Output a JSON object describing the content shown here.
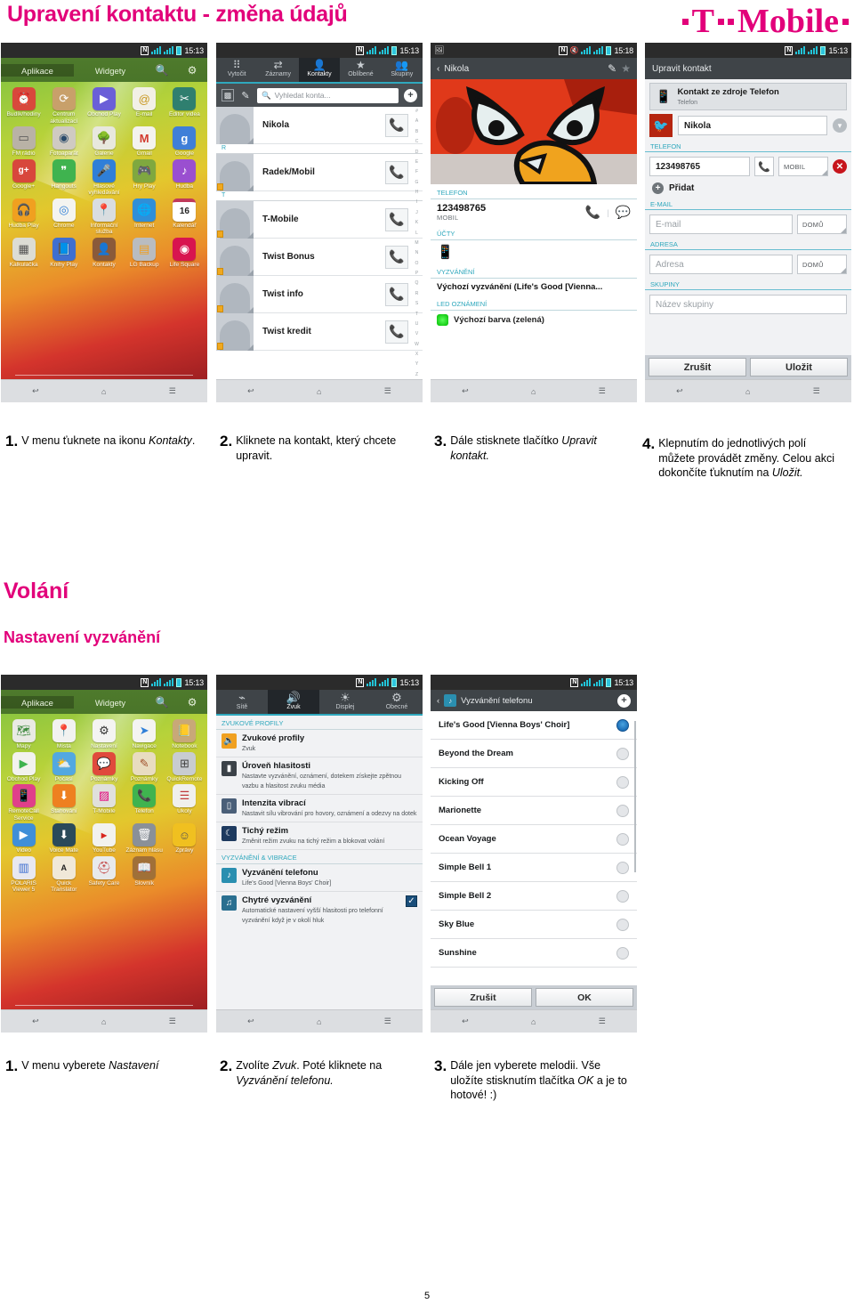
{
  "header": {
    "title": "Upravení kontaktu - změna údajů",
    "logo_t": "T",
    "logo_word": "Mobile",
    "brand_color": "#e2007a"
  },
  "sections": {
    "volani": "Volání",
    "nastaveni_vyzvaneni": "Nastavení vyzvánění"
  },
  "page_number": "5",
  "phones": {
    "home_apps": {
      "status": {
        "nfc": "N",
        "time": "15:13"
      },
      "tabs": [
        {
          "label": "Aplikace",
          "active": true
        },
        {
          "label": "Widgety",
          "active": false
        }
      ],
      "search_icon": "search-icon",
      "settings_icon": "gear-icon",
      "apps": [
        {
          "label": "Budík/hodiny",
          "glyph": "⏰",
          "color": "#d8483c"
        },
        {
          "label": "Centrum aktualizací",
          "glyph": "⟳",
          "color": "#c8a06a"
        },
        {
          "label": "Obchod Play",
          "glyph": "▶",
          "color": "#6a5fd8"
        },
        {
          "label": "E-mail",
          "glyph": "@",
          "color": "#f2f0e6"
        },
        {
          "label": "Editor videa",
          "glyph": "✂",
          "color": "#2f7f6f"
        },
        {
          "label": "FM rádio",
          "glyph": "📻",
          "color": "#b9b2a6"
        },
        {
          "label": "Fotoaparát",
          "glyph": "◉",
          "color": "#cfcac2"
        },
        {
          "label": "Galerie",
          "glyph": "🌳",
          "color": "#e8e8de"
        },
        {
          "label": "Gmail",
          "glyph": "M",
          "color": "#f4f3ee"
        },
        {
          "label": "Google",
          "glyph": "g",
          "color": "#3f7fd8"
        },
        {
          "label": "Google+",
          "glyph": "g+",
          "color": "#d8473c"
        },
        {
          "label": "Hangouts",
          "glyph": "❞",
          "color": "#3fb34f"
        },
        {
          "label": "Hlasové vyhledávání",
          "glyph": "🎤",
          "color": "#2f7fd8"
        },
        {
          "label": "Hry Play",
          "glyph": "🎮",
          "color": "#7fa83f"
        },
        {
          "label": "Hudba",
          "glyph": "♪",
          "color": "#9a4fd0"
        },
        {
          "label": "Hudba Play",
          "glyph": "🎧",
          "color": "#f0a020"
        },
        {
          "label": "Chrome",
          "glyph": "◎",
          "color": "#f4f4f0"
        },
        {
          "label": "Informační služba",
          "glyph": "📍",
          "color": "#d9dde0"
        },
        {
          "label": "Internet",
          "glyph": "🌐",
          "color": "#2f8fd8"
        },
        {
          "label": "Kalendář",
          "glyph": "16",
          "color": "#ffffff"
        },
        {
          "label": "Kalkulačka",
          "glyph": "▦",
          "color": "#dcdcd4"
        },
        {
          "label": "Knihy Play",
          "glyph": "📘",
          "color": "#3f6fd0"
        },
        {
          "label": "Kontakty",
          "glyph": "👤",
          "color": "#8a5a3a"
        },
        {
          "label": "LG Backup",
          "glyph": "▤",
          "color": "#b9bcc0"
        },
        {
          "label": "Life Square",
          "glyph": "◉",
          "color": "#d8144f"
        }
      ]
    },
    "contacts": {
      "status": {
        "nfc": "N",
        "time": "15:13"
      },
      "tabs": [
        {
          "label": "Vytočit",
          "glyph": "⠿",
          "active": false
        },
        {
          "label": "Záznamy",
          "glyph": "⇄",
          "active": false
        },
        {
          "label": "Kontakty",
          "glyph": "👤",
          "active": true
        },
        {
          "label": "Oblíbené",
          "glyph": "★",
          "active": false
        },
        {
          "label": "Skupiny",
          "glyph": "👥",
          "active": false
        }
      ],
      "search_placeholder": "Vyhledat konta...",
      "add_label": "+",
      "rows": [
        {
          "name": "Nikola",
          "sim": false,
          "section": ""
        },
        {
          "name": "Radek/Mobil",
          "sim": true,
          "section": "R"
        },
        {
          "name": "T-Mobile",
          "sim": true,
          "section": "T"
        },
        {
          "name": "Twist Bonus",
          "sim": true,
          "section": ""
        },
        {
          "name": "Twist info",
          "sim": true,
          "section": ""
        },
        {
          "name": "Twist kredit",
          "sim": true,
          "section": ""
        }
      ],
      "index": [
        "#",
        "A",
        "B",
        "C",
        "D",
        "E",
        "F",
        "G",
        "H",
        "I",
        "J",
        "K",
        "L",
        "M",
        "N",
        "O",
        "P",
        "Q",
        "R",
        "S",
        "T",
        "U",
        "V",
        "W",
        "X",
        "Y",
        "Z"
      ]
    },
    "contact_detail": {
      "status": {
        "nfc": "N",
        "time": "15:18"
      },
      "title": "Nikola",
      "back_icon": "back-chevron-icon",
      "edit_icon": "pencil-icon",
      "favorite_icon": "star-icon",
      "sections": [
        {
          "label": "TELEFON"
        },
        {
          "label": "ÚČTY"
        },
        {
          "label": "VYZVÁNĚNÍ"
        },
        {
          "label": "LED OZNÁMENÍ"
        }
      ],
      "phone_number": "123498765",
      "phone_type": "MOBIL",
      "ringtone": "Výchozí vyzvánění (Life's Good [Vienna...",
      "led_color": "Výchozí barva (zelená)"
    },
    "edit_contact": {
      "status": {
        "nfc": "N",
        "time": "15:13"
      },
      "title": "Upravit kontakt",
      "source_title": "Kontakt ze zdroje Telefon",
      "source_sub": "Telefon",
      "name_value": "Nikola",
      "sections": {
        "phone": "TELEFON",
        "email": "E-MAIL",
        "address": "ADRESA",
        "groups": "SKUPINY"
      },
      "phone_value": "123498765",
      "phone_type": "MOBIL",
      "add_label": "Přidat",
      "email_placeholder": "E-mail",
      "email_type": "DOMŮ",
      "address_placeholder": "Adresa",
      "address_type": "DOMŮ",
      "group_placeholder": "Název skupiny",
      "cancel_label": "Zrušit",
      "save_label": "Uložit"
    },
    "home_apps2": {
      "status": {
        "nfc": "N",
        "time": "15:13"
      },
      "tabs": [
        {
          "label": "Aplikace",
          "active": true
        },
        {
          "label": "Widgety",
          "active": false
        }
      ],
      "apps": [
        {
          "label": "Mapy",
          "glyph": "🗺",
          "color": "#e9eae4"
        },
        {
          "label": "Místa",
          "glyph": "📍",
          "color": "#f2f2f0"
        },
        {
          "label": "Nastavení",
          "glyph": "⚙",
          "color": "#f4f4f2"
        },
        {
          "label": "Navigace",
          "glyph": "➤",
          "color": "#f4f4f2"
        },
        {
          "label": "Notebook",
          "glyph": "📒",
          "color": "#c8a878"
        },
        {
          "label": "Obchod Play",
          "glyph": "▶",
          "color": "#f2f2ee"
        },
        {
          "label": "Počasí",
          "glyph": "⛅",
          "color": "#52a8e0"
        },
        {
          "label": "Poznámky",
          "glyph": "💬",
          "color": "#e04a3c"
        },
        {
          "label": "Poznámky",
          "glyph": "✎",
          "color": "#e8dcc0"
        },
        {
          "label": "QuickRemote",
          "glyph": "⊞",
          "color": "#c8ccd0"
        },
        {
          "label": "RemoteCall Service",
          "glyph": "📱",
          "color": "#e0408a"
        },
        {
          "label": "Stahování",
          "glyph": "⬇",
          "color": "#ee8020"
        },
        {
          "label": "T-Mobile",
          "glyph": "▨",
          "color": "#e0e0dc"
        },
        {
          "label": "Telefon",
          "glyph": "📞",
          "color": "#3fb34f"
        },
        {
          "label": "Úkoly",
          "glyph": "☰",
          "color": "#f0f0ec"
        },
        {
          "label": "Video",
          "glyph": "▶",
          "color": "#3f8fd8"
        },
        {
          "label": "Voice Mate",
          "glyph": "⬇",
          "color": "#2a4a5a"
        },
        {
          "label": "YouTube",
          "glyph": "▶",
          "color": "#f2f2ee"
        },
        {
          "label": "Záznam hlasu",
          "glyph": "🗑",
          "color": "#8a9098"
        },
        {
          "label": "Zprávy",
          "glyph": "☺",
          "color": "#f0c020"
        },
        {
          "label": "POLARIS Viewer 5",
          "glyph": "▥",
          "color": "#e8e8f0"
        },
        {
          "label": "Quick Translator",
          "glyph": "A",
          "color": "#f0e8d8"
        },
        {
          "label": "Safety Care",
          "glyph": "⛑",
          "color": "#e8eaec"
        },
        {
          "label": "Slovník",
          "glyph": "📖",
          "color": "#a07038"
        }
      ]
    },
    "sound_settings": {
      "status": {
        "nfc": "N",
        "time": "15:13"
      },
      "tabs": [
        {
          "label": "Sítě",
          "glyph": "⌁",
          "active": false
        },
        {
          "label": "Zvuk",
          "glyph": "🔊",
          "active": true
        },
        {
          "label": "Displej",
          "glyph": "☀",
          "active": false
        },
        {
          "label": "Obecné",
          "glyph": "⚙",
          "active": false
        }
      ],
      "sections": [
        {
          "label": "ZVUKOVÉ PROFILY"
        },
        {
          "label": "VYZVÁNĚNÍ & VIBRACE"
        }
      ],
      "items": [
        {
          "title": "Zvukové profily",
          "sub": "Zvuk",
          "glyph": "🔈",
          "color": "#f0a020",
          "check": false
        },
        {
          "title": "Úroveň hlasitosti",
          "sub": "Nastavte vyzvánění, oznámení, dotekem získejte zpětnou vazbu a hlasitost zvuku média",
          "glyph": "▮",
          "color": "#3b4248",
          "check": false
        },
        {
          "title": "Intenzita vibrací",
          "sub": "Nastavit sílu vibrování pro hovory, oznámení a odezvy na dotek",
          "glyph": "📳",
          "color": "#4a5f78",
          "check": false
        },
        {
          "title": "Tichý režim",
          "sub": "Změnit režim zvuku na tichý režim a blokovat volání",
          "glyph": "☾",
          "color": "#1e3a5f",
          "check": false
        },
        {
          "title": "Vyzvánění telefonu",
          "sub": "Life's Good [Vienna Boys' Choir]",
          "glyph": "♪",
          "color": "#2a8fb0",
          "check": false
        },
        {
          "title": "Chytré vyzvánění",
          "sub": "Automatické nastavení vyšší hlasitosti pro telefonní vyzvánění když je v okolí hluk",
          "glyph": "♫",
          "color": "#2a6f90",
          "check": true
        }
      ]
    },
    "ringtone_picker": {
      "status": {
        "nfc": "N",
        "time": "15:13"
      },
      "title": "Vyzvánění telefonu",
      "add_label": "+",
      "items": [
        {
          "label": "Life's Good [Vienna Boys' Choir]",
          "selected": true
        },
        {
          "label": "Beyond the Dream",
          "selected": false
        },
        {
          "label": "Kicking Off",
          "selected": false
        },
        {
          "label": "Marionette",
          "selected": false
        },
        {
          "label": "Ocean Voyage",
          "selected": false
        },
        {
          "label": "Simple Bell 1",
          "selected": false
        },
        {
          "label": "Simple Bell 2",
          "selected": false
        },
        {
          "label": "Sky Blue",
          "selected": false
        },
        {
          "label": "Sunshine",
          "selected": false
        }
      ],
      "cancel_label": "Zrušit",
      "ok_label": "OK"
    }
  },
  "captions_row1": [
    {
      "num": "1.",
      "html": "V menu ťuknete na ikonu <i>Kontakty</i>."
    },
    {
      "num": "2.",
      "html": "Kliknete na kontakt, který chcete upravit."
    },
    {
      "num": "3.",
      "html": "Dále stisknete tlačítko <i>Upravit kontakt.</i>"
    },
    {
      "num": "4.",
      "html": "Klepnutím do jednotlivých polí můžete provádět změny. Celou akci dokončíte ťuknutím na <i>Uložit.</i>"
    }
  ],
  "captions_row2": [
    {
      "num": "1.",
      "html": "V menu vyberete <i>Nastavení</i>"
    },
    {
      "num": "2.",
      "html": "Zvolíte <i>Zvuk</i>. Poté kliknete na <i>Vyzvánění telefonu.</i>"
    },
    {
      "num": "3.",
      "html": "Dále jen vyberete melodii. Vše uložíte stisknutím tlačítka <i>OK</i> a je to hotové! :)"
    }
  ]
}
